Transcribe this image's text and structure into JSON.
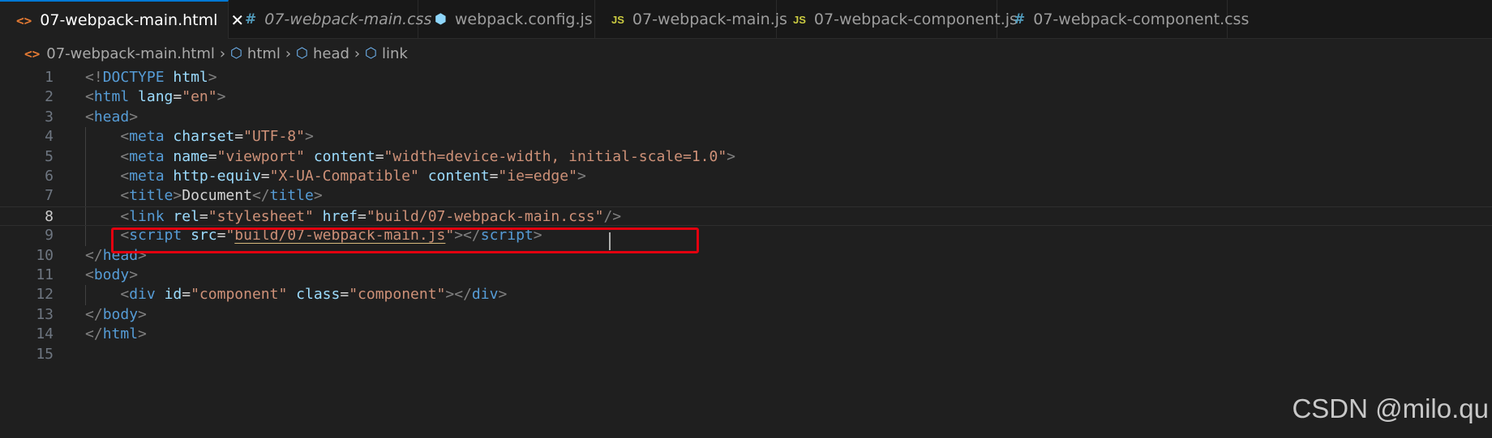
{
  "tabs": [
    {
      "icon": "<>",
      "icon_type": "html",
      "label": "07-webpack-main.html",
      "active": true,
      "close": "✕"
    },
    {
      "icon": "#",
      "icon_type": "css",
      "label": "07-webpack-main.css",
      "italic": true
    },
    {
      "icon": "⬢",
      "icon_type": "cfg",
      "label": "webpack.config.js"
    },
    {
      "icon": "JS",
      "icon_type": "js",
      "label": "07-webpack-main.js"
    },
    {
      "icon": "JS",
      "icon_type": "js",
      "label": "07-webpack-component.js"
    },
    {
      "icon": "#",
      "icon_type": "css",
      "label": "07-webpack-component.css"
    }
  ],
  "breadcrumb": {
    "file_icon": "<>",
    "file": "07-webpack-main.html",
    "items": [
      "html",
      "head",
      "link"
    ]
  },
  "editor": {
    "line_numbers": [
      "1",
      "2",
      "3",
      "4",
      "5",
      "6",
      "7",
      "8",
      "9",
      "10",
      "11",
      "12",
      "13",
      "14",
      "15"
    ],
    "current_line": 8,
    "lines": [
      [
        [
          "br",
          "<!"
        ],
        [
          "tag",
          "DOCTYPE"
        ],
        [
          "txt",
          " "
        ],
        [
          "attr",
          "html"
        ],
        [
          "br",
          ">"
        ]
      ],
      [
        [
          "br",
          "<"
        ],
        [
          "tag",
          "html"
        ],
        [
          "txt",
          " "
        ],
        [
          "attr",
          "lang"
        ],
        [
          "eq",
          "="
        ],
        [
          "str",
          "\"en\""
        ],
        [
          "br",
          ">"
        ]
      ],
      [
        [
          "br",
          "<"
        ],
        [
          "tag",
          "head"
        ],
        [
          "br",
          ">"
        ]
      ],
      [
        [
          "txt",
          "    "
        ],
        [
          "br",
          "<"
        ],
        [
          "tag",
          "meta"
        ],
        [
          "txt",
          " "
        ],
        [
          "attr",
          "charset"
        ],
        [
          "eq",
          "="
        ],
        [
          "str",
          "\"UTF-8\""
        ],
        [
          "br",
          ">"
        ]
      ],
      [
        [
          "txt",
          "    "
        ],
        [
          "br",
          "<"
        ],
        [
          "tag",
          "meta"
        ],
        [
          "txt",
          " "
        ],
        [
          "attr",
          "name"
        ],
        [
          "eq",
          "="
        ],
        [
          "str",
          "\"viewport\""
        ],
        [
          "txt",
          " "
        ],
        [
          "attr",
          "content"
        ],
        [
          "eq",
          "="
        ],
        [
          "str",
          "\"width=device-width, initial-scale=1.0\""
        ],
        [
          "br",
          ">"
        ]
      ],
      [
        [
          "txt",
          "    "
        ],
        [
          "br",
          "<"
        ],
        [
          "tag",
          "meta"
        ],
        [
          "txt",
          " "
        ],
        [
          "attr",
          "http-equiv"
        ],
        [
          "eq",
          "="
        ],
        [
          "str",
          "\"X-UA-Compatible\""
        ],
        [
          "txt",
          " "
        ],
        [
          "attr",
          "content"
        ],
        [
          "eq",
          "="
        ],
        [
          "str",
          "\"ie=edge\""
        ],
        [
          "br",
          ">"
        ]
      ],
      [
        [
          "txt",
          "    "
        ],
        [
          "br",
          "<"
        ],
        [
          "tag",
          "title"
        ],
        [
          "br",
          ">"
        ],
        [
          "txt",
          "Document"
        ],
        [
          "br",
          "</"
        ],
        [
          "tag",
          "title"
        ],
        [
          "br",
          ">"
        ]
      ],
      [
        [
          "txt",
          "    "
        ],
        [
          "br",
          "<"
        ],
        [
          "tag",
          "link"
        ],
        [
          "txt",
          " "
        ],
        [
          "attr",
          "rel"
        ],
        [
          "eq",
          "="
        ],
        [
          "str",
          "\"stylesheet\""
        ],
        [
          "txt",
          " "
        ],
        [
          "attr",
          "href"
        ],
        [
          "eq",
          "="
        ],
        [
          "str",
          "\"build/07-webpack-main.css\""
        ],
        [
          "br",
          "/>"
        ]
      ],
      [
        [
          "txt",
          "    "
        ],
        [
          "br",
          "<"
        ],
        [
          "tag",
          "script"
        ],
        [
          "txt",
          " "
        ],
        [
          "attr",
          "src"
        ],
        [
          "eq",
          "="
        ],
        [
          "str",
          "\""
        ],
        [
          "sq",
          "build/07-webpack-main.js"
        ],
        [
          "str",
          "\""
        ],
        [
          "br",
          "></"
        ],
        [
          "tag",
          "script"
        ],
        [
          "br",
          ">"
        ]
      ],
      [
        [
          "br",
          "</"
        ],
        [
          "tag",
          "head"
        ],
        [
          "br",
          ">"
        ]
      ],
      [
        [
          "br",
          "<"
        ],
        [
          "tag",
          "body"
        ],
        [
          "br",
          ">"
        ]
      ],
      [
        [
          "txt",
          "    "
        ],
        [
          "br",
          "<"
        ],
        [
          "tag",
          "div"
        ],
        [
          "txt",
          " "
        ],
        [
          "attr",
          "id"
        ],
        [
          "eq",
          "="
        ],
        [
          "str",
          "\"component\""
        ],
        [
          "txt",
          " "
        ],
        [
          "attr",
          "class"
        ],
        [
          "eq",
          "="
        ],
        [
          "str",
          "\"component\""
        ],
        [
          "br",
          "></"
        ],
        [
          "tag",
          "div"
        ],
        [
          "br",
          ">"
        ]
      ],
      [
        [
          "br",
          "</"
        ],
        [
          "tag",
          "body"
        ],
        [
          "br",
          ">"
        ]
      ],
      [
        [
          "br",
          "</"
        ],
        [
          "tag",
          "html"
        ],
        [
          "br",
          ">"
        ]
      ],
      []
    ]
  },
  "watermark": "CSDN @milo.qu",
  "colors": {
    "highlight_border": "#e3000f",
    "active_tab_accent": "#0078d4",
    "tag": "#569cd6",
    "attr": "#9cdcfe",
    "string": "#ce9178"
  }
}
